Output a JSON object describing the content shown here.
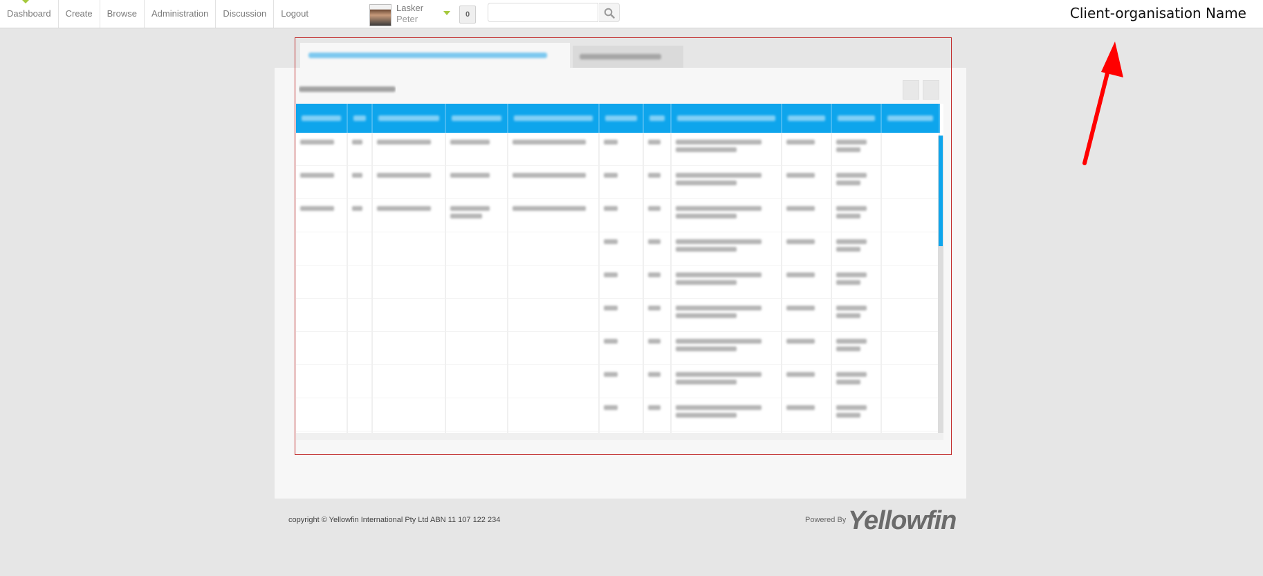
{
  "nav": {
    "items": [
      "Dashboard",
      "Create",
      "Browse",
      "Administration",
      "Discussion",
      "Logout"
    ]
  },
  "user": {
    "last_name": "Lasker",
    "first_name": "Peter",
    "avatar_icon": "user-avatar-photo",
    "notification_count": "0"
  },
  "search": {
    "value": "",
    "placeholder": "",
    "icon": "search-icon"
  },
  "client_name": "Client-organisation Name",
  "annotation": {
    "arrow_color": "#ff0000",
    "box_color": "#c12b2b"
  },
  "report": {
    "tabs": [
      {
        "label": "",
        "state": "active"
      },
      {
        "label": "",
        "state": "inactive"
      }
    ],
    "title": "",
    "header_color": "#0ea5ec",
    "columns": [
      "",
      "",
      "",
      "",
      "",
      "",
      "",
      "",
      "",
      "",
      ""
    ],
    "rows": [
      [
        "",
        "",
        "",
        "",
        "",
        "",
        "",
        "",
        "",
        "",
        ""
      ],
      [
        "",
        "",
        "",
        "",
        "",
        "",
        "",
        "",
        "",
        "",
        ""
      ],
      [
        "",
        "",
        "",
        "",
        "",
        "",
        "",
        "",
        "",
        "",
        ""
      ],
      [
        "",
        "",
        "",
        "",
        "",
        "",
        "",
        "",
        "",
        "",
        ""
      ],
      [
        "",
        "",
        "",
        "",
        "",
        "",
        "",
        "",
        "",
        "",
        ""
      ],
      [
        "",
        "",
        "",
        "",
        "",
        "",
        "",
        "",
        "",
        "",
        ""
      ],
      [
        "",
        "",
        "",
        "",
        "",
        "",
        "",
        "",
        "",
        "",
        ""
      ],
      [
        "",
        "",
        "",
        "",
        "",
        "",
        "",
        "",
        "",
        "",
        ""
      ],
      [
        "",
        "",
        "",
        "",
        "",
        "",
        "",
        "",
        "",
        "",
        ""
      ],
      [
        "",
        "",
        "",
        "",
        "",
        "",
        "",
        "",
        "",
        "",
        ""
      ],
      [
        "",
        "",
        "",
        "",
        "",
        "",
        "",
        "",
        "",
        "",
        ""
      ]
    ],
    "note": "All report content is blurred/obscured in the screenshot"
  },
  "footer": {
    "copyright": "copyright © Yellowfin International Pty Ltd ABN 11 107 122 234",
    "powered_by": "Powered By",
    "logo_text": "Yellowfin"
  }
}
